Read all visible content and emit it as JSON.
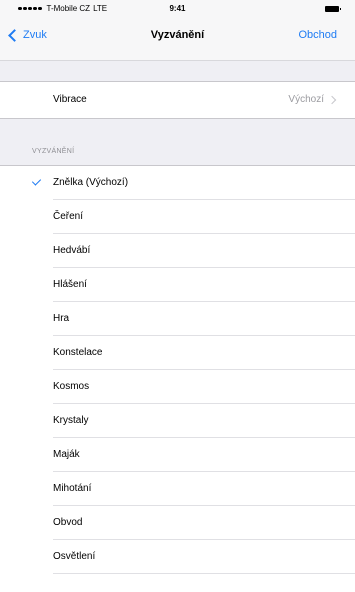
{
  "status_bar": {
    "carrier": "T-Mobile CZ",
    "network": "LTE",
    "time": "9:41"
  },
  "nav": {
    "back_label": "Zvuk",
    "title": "Vyzvánění",
    "right_label": "Obchod"
  },
  "vibration": {
    "label": "Vibrace",
    "value": "Výchozí"
  },
  "ringtones": {
    "header": "VYZVÁNĚNÍ",
    "selected_index": 0,
    "items": [
      "Znělka (Výchozí)",
      "Čeření",
      "Hedvábí",
      "Hlášení",
      "Hra",
      "Konstelace",
      "Kosmos",
      "Krystaly",
      "Maják",
      "Mihotání",
      "Obvod",
      "Osvětlení"
    ]
  },
  "colors": {
    "accent": "#1f7cf3",
    "background": "#efeff4",
    "secondary_text": "#9b9ba0"
  }
}
